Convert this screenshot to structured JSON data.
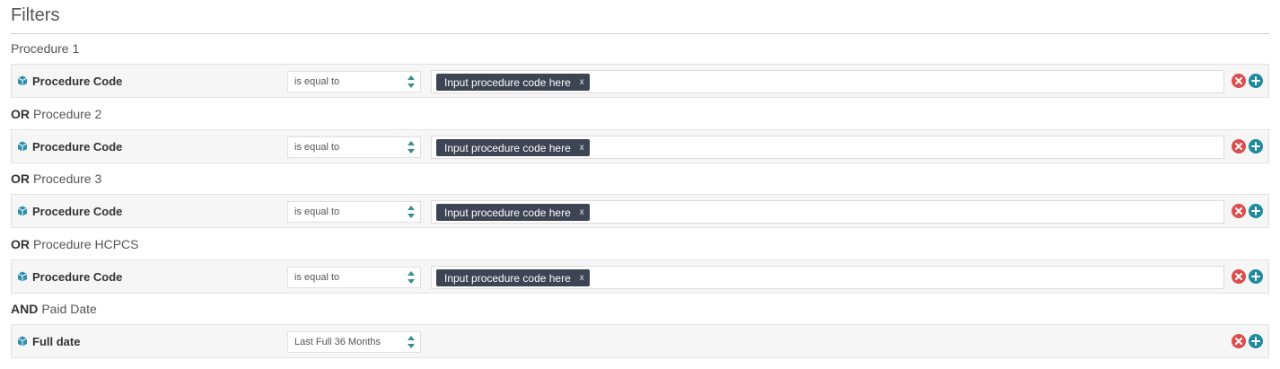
{
  "header": {
    "title": "Filters"
  },
  "groups": [
    {
      "operator": "",
      "label": "Procedure 1",
      "field": "Procedure Code",
      "comparator": "is equal to",
      "value_chip": "Input procedure code here",
      "chip_remove": "x"
    },
    {
      "operator": "OR",
      "label": "Procedure 2",
      "field": "Procedure Code",
      "comparator": "is equal to",
      "value_chip": "Input procedure code here",
      "chip_remove": "x"
    },
    {
      "operator": "OR",
      "label": "Procedure 3",
      "field": "Procedure Code",
      "comparator": "is equal to",
      "value_chip": "Input procedure code here",
      "chip_remove": "x"
    },
    {
      "operator": "OR",
      "label": "Procedure HCPCS",
      "field": "Procedure Code",
      "comparator": "is equal to",
      "value_chip": "Input procedure code here",
      "chip_remove": "x"
    },
    {
      "operator": "AND",
      "label": "Paid Date",
      "field": "Full date",
      "comparator": "Last Full 36 Months"
    }
  ],
  "icons": {
    "field": "cube-icon",
    "select": "updown-arrows-icon",
    "remove": "remove-circle-icon",
    "add": "add-circle-icon"
  },
  "colors": {
    "chip_bg": "#3d4453",
    "remove": "#dc4e4e",
    "add": "#1e8a9c",
    "cube": "#2f8fb0"
  }
}
